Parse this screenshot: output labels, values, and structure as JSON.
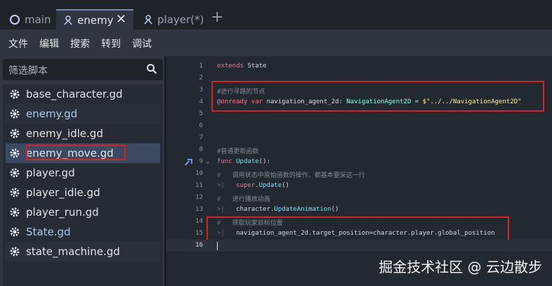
{
  "tabs": [
    {
      "label": "main"
    },
    {
      "label": "enemy"
    },
    {
      "label": "player(*)"
    }
  ],
  "tab_close": "✕",
  "tab_add": "+",
  "menu": [
    "文件",
    "编辑",
    "搜索",
    "转到",
    "调试"
  ],
  "filter": {
    "placeholder": "筛选脚本"
  },
  "files": [
    {
      "name": "base_character.gd"
    },
    {
      "name": "enemy.gd"
    },
    {
      "name": "enemy_idle.gd"
    },
    {
      "name": "enemy_move.gd"
    },
    {
      "name": "player.gd"
    },
    {
      "name": "player_idle.gd"
    },
    {
      "name": "player_run.gd"
    },
    {
      "name": "State.gd"
    },
    {
      "name": "state_machine.gd"
    }
  ],
  "code": {
    "line_numbers": [
      "1",
      "2",
      "3",
      "4",
      "5",
      "6",
      "7",
      "8",
      "9",
      "10",
      "11",
      "12",
      "13",
      "14",
      "15",
      "16"
    ],
    "l1_kw": "extends",
    "l1_rest": " State",
    "l3": "#进行寻路的节点",
    "l4_kw1": "@onready",
    "l4_kw2": " var",
    "l4_name": " navigation_agent_2d: ",
    "l4_type": "NavigationAgent2D",
    "l4_eq": " = ",
    "l4_str": "$\"../../NavigationAgent2D\"",
    "l8": "#普通更新函数",
    "l9_kw": "func",
    "l9_fn": " Update",
    "l9_rest": "():",
    "l10": "调用状态中原始函数的操作，都基本要采这一行",
    "l11_kw": "super",
    "l11_fn": ".Update",
    "l11_rest": "()",
    "l12": "进行播放动画",
    "l13_a": "character.",
    "l13_fn": "UpdateAnimation",
    "l13_b": "()",
    "l14": "获取玩家目标位置",
    "l15": "navigation_agent_2d.target_position=character.player.global_position",
    "comment_mark": "#",
    "indent_mark": ">|"
  },
  "watermark": "掘金技术社区 @ 云边散步"
}
